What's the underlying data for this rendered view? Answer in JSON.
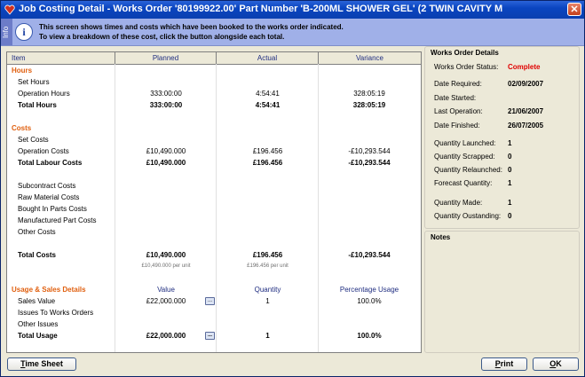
{
  "window": {
    "title": "Job Costing Detail - Works Order '80199922.00'   Part Number 'B-200ML SHOWER GEL'  (2 TWIN CAVITY M",
    "close_label": "✕"
  },
  "info": {
    "side_label": "Info",
    "line1": "This screen shows times and costs which have been booked to the works order indicated.",
    "line2": "To view a breakdown of these cost, click the button alongside each total."
  },
  "grid": {
    "headers": {
      "item": "Item",
      "planned": "Planned",
      "actual": "Actual",
      "variance": "Variance"
    },
    "hours": {
      "section": "Hours",
      "set_hours": "Set Hours",
      "operation_hours": {
        "label": "Operation Hours",
        "planned": "333:00:00",
        "actual": "4:54:41",
        "variance": "328:05:19"
      },
      "total_hours": {
        "label": "Total Hours",
        "planned": "333:00:00",
        "actual": "4:54:41",
        "variance": "328:05:19"
      }
    },
    "costs": {
      "section": "Costs",
      "set_costs": "Set Costs",
      "operation_costs": {
        "label": "Operation Costs",
        "planned": "£10,490.000",
        "actual": "£196.456",
        "variance": "-£10,293.544"
      },
      "total_labour": {
        "label": "Total Labour Costs",
        "planned": "£10,490.000",
        "actual": "£196.456",
        "variance": "-£10,293.544"
      },
      "subcontract": "Subcontract Costs",
      "raw_material": "Raw Material Costs",
      "bought_in": "Bought In Parts Costs",
      "manufactured": "Manufactured Part Costs",
      "other": "Other Costs",
      "total_costs": {
        "label": "Total Costs",
        "planned": "£10,490.000",
        "actual": "£196.456",
        "variance": "-£10,293.544"
      },
      "per_unit": {
        "planned": "£10,490.000 per unit",
        "actual": "£196.456 per unit"
      }
    },
    "usage": {
      "section": "Usage & Sales Details",
      "col_value": "Value",
      "col_quantity": "Quantity",
      "col_percent": "Percentage Usage",
      "sales_value": {
        "label": "Sales Value",
        "value": "£22,000.000",
        "quantity": "1",
        "percent": "100.0%"
      },
      "issues_to_wo": "Issues To Works Orders",
      "other_issues": "Other Issues",
      "total_usage": {
        "label": "Total Usage",
        "value": "£22,000.000",
        "quantity": "1",
        "percent": "100.0%"
      },
      "ellipsis": "..."
    }
  },
  "details": {
    "title": "Works Order Details",
    "status": {
      "label": "Works Order Status:",
      "value": "Complete",
      "color": "#e00000"
    },
    "date_required": {
      "label": "Date Required:",
      "value": "02/09/2007"
    },
    "date_started": {
      "label": "Date Started:",
      "value": ""
    },
    "last_operation": {
      "label": "Last Operation:",
      "value": "21/06/2007"
    },
    "date_finished": {
      "label": "Date Finished:",
      "value": "26/07/2005"
    },
    "qty_launched": {
      "label": "Quantity Launched:",
      "value": "1"
    },
    "qty_scrapped": {
      "label": "Quantity Scrapped:",
      "value": "0"
    },
    "qty_relaunched": {
      "label": "Quantity Relaunched:",
      "value": "0"
    },
    "forecast_qty": {
      "label": "Forecast Quantity:",
      "value": "1"
    },
    "qty_made": {
      "label": "Quantity Made:",
      "value": "1"
    },
    "qty_outstanding": {
      "label": "Quantity Oustanding:",
      "value": "0"
    }
  },
  "notes": {
    "title": "Notes"
  },
  "buttons": {
    "time_sheet": {
      "underline": "T",
      "rest": "ime Sheet"
    },
    "print": {
      "underline": "P",
      "rest": "rint"
    },
    "ok": {
      "underline": "O",
      "rest": "K"
    }
  }
}
